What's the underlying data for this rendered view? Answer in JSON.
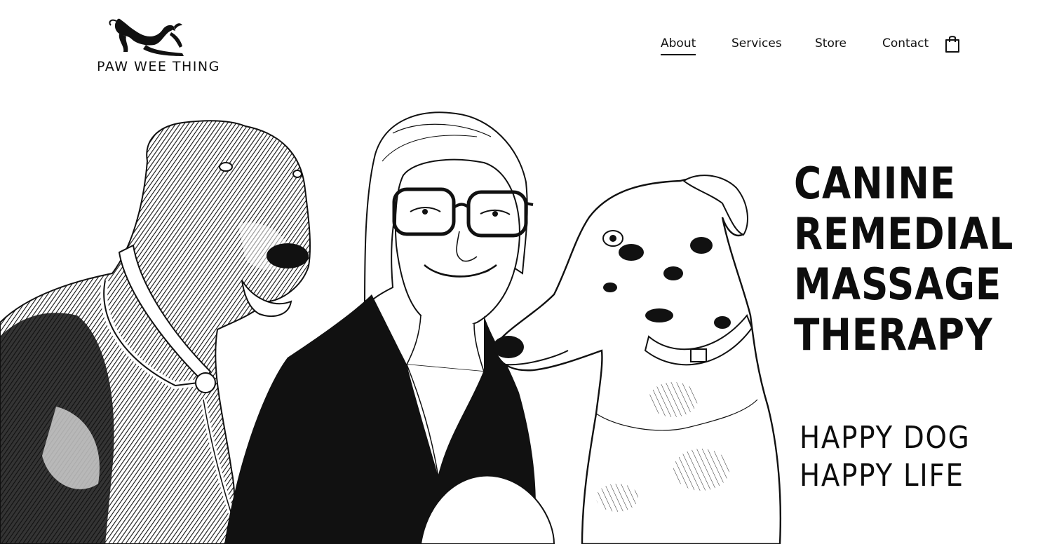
{
  "brand": {
    "logo_text": "PAW WEE THING",
    "logo_icon": "greyhound-dog-icon"
  },
  "nav": {
    "items": [
      {
        "label": "About",
        "active": true
      },
      {
        "label": "Services",
        "active": false
      },
      {
        "label": "Store",
        "active": false
      },
      {
        "label": "Contact",
        "active": false
      }
    ],
    "cart_icon": "shopping-bag-icon"
  },
  "hero": {
    "headline_lines": [
      "CANINE",
      "REMEDIAL",
      "MASSAGE",
      "THERAPY"
    ],
    "tagline_lines": [
      "HAPPY DOG",
      "HAPPY LIFE"
    ],
    "illustration": "pen-and-ink-drawing-woman-with-two-greyhounds"
  },
  "colors": {
    "background": "#ffffff",
    "ink": "#111111"
  }
}
